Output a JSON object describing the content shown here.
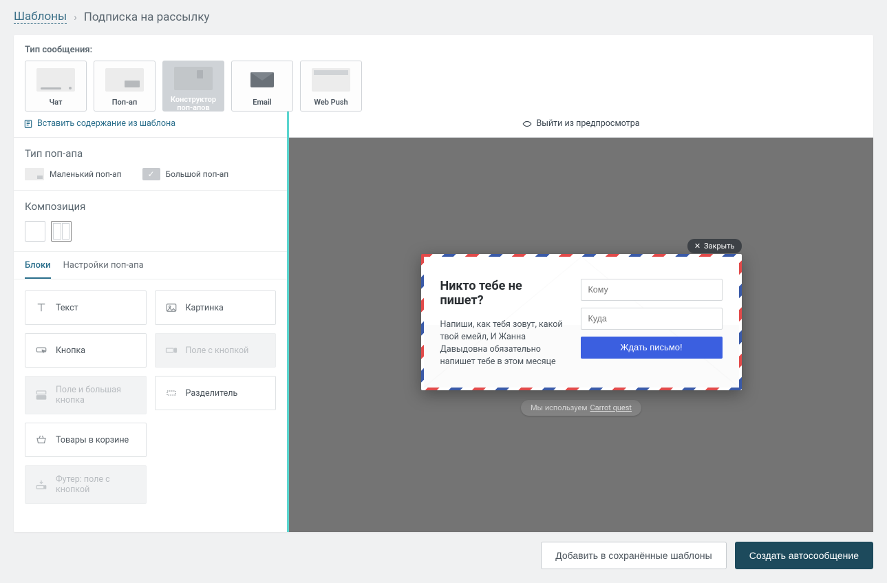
{
  "breadcrumb": {
    "root": "Шаблоны",
    "current": "Подписка на рассылку"
  },
  "messageType": {
    "label": "Тип сообщения:",
    "options": [
      {
        "id": "chat",
        "label": "Чат"
      },
      {
        "id": "popup",
        "label": "Поп-ап"
      },
      {
        "id": "builder",
        "label": "Конструктор поп-апов"
      },
      {
        "id": "email",
        "label": "Email"
      },
      {
        "id": "webpush",
        "label": "Web Push"
      }
    ],
    "active": "builder"
  },
  "sidebar": {
    "insertTemplate": "Вставить содержание из шаблона",
    "popupType": {
      "title": "Тип поп-апа",
      "small": "Маленький поп-ап",
      "big": "Большой поп-ап",
      "selected": "big"
    },
    "composition": {
      "title": "Композиция"
    },
    "tabs": {
      "blocks": "Блоки",
      "settings": "Настройки поп-апа",
      "active": "blocks"
    },
    "blocks": [
      {
        "id": "text",
        "label": "Текст",
        "disabled": false
      },
      {
        "id": "image",
        "label": "Картинка",
        "disabled": false
      },
      {
        "id": "button",
        "label": "Кнопка",
        "disabled": false
      },
      {
        "id": "input-button",
        "label": "Поле с кнопкой",
        "disabled": true
      },
      {
        "id": "input-big-button",
        "label": "Поле и большая кнопка",
        "disabled": true
      },
      {
        "id": "divider",
        "label": "Разделитель",
        "disabled": false
      },
      {
        "id": "cart",
        "label": "Товары в корзине",
        "disabled": false
      },
      {
        "id": "spacer",
        "label": "",
        "disabled": false,
        "hidden": true
      },
      {
        "id": "footer-input",
        "label": "Футер: поле с кнопкой",
        "disabled": true
      }
    ]
  },
  "preview": {
    "exitLabel": "Выйти из предпросмотра",
    "closeLabel": "Закрыть",
    "popup": {
      "title": "Никто тебе не пишет?",
      "body": "Напиши, как тебя зовут, какой твой емейл, И Жанна Давыдовна обязательно напишет тебе в этом месяце",
      "input1Placeholder": "Кому",
      "input2Placeholder": "Куда",
      "buttonLabel": "Ждать письмо!"
    },
    "powered": {
      "prefix": "Мы используем ",
      "brand": "Carrot quest"
    }
  },
  "footer": {
    "saveTemplate": "Добавить в сохранённые шаблоны",
    "createAuto": "Создать автосообщение"
  }
}
